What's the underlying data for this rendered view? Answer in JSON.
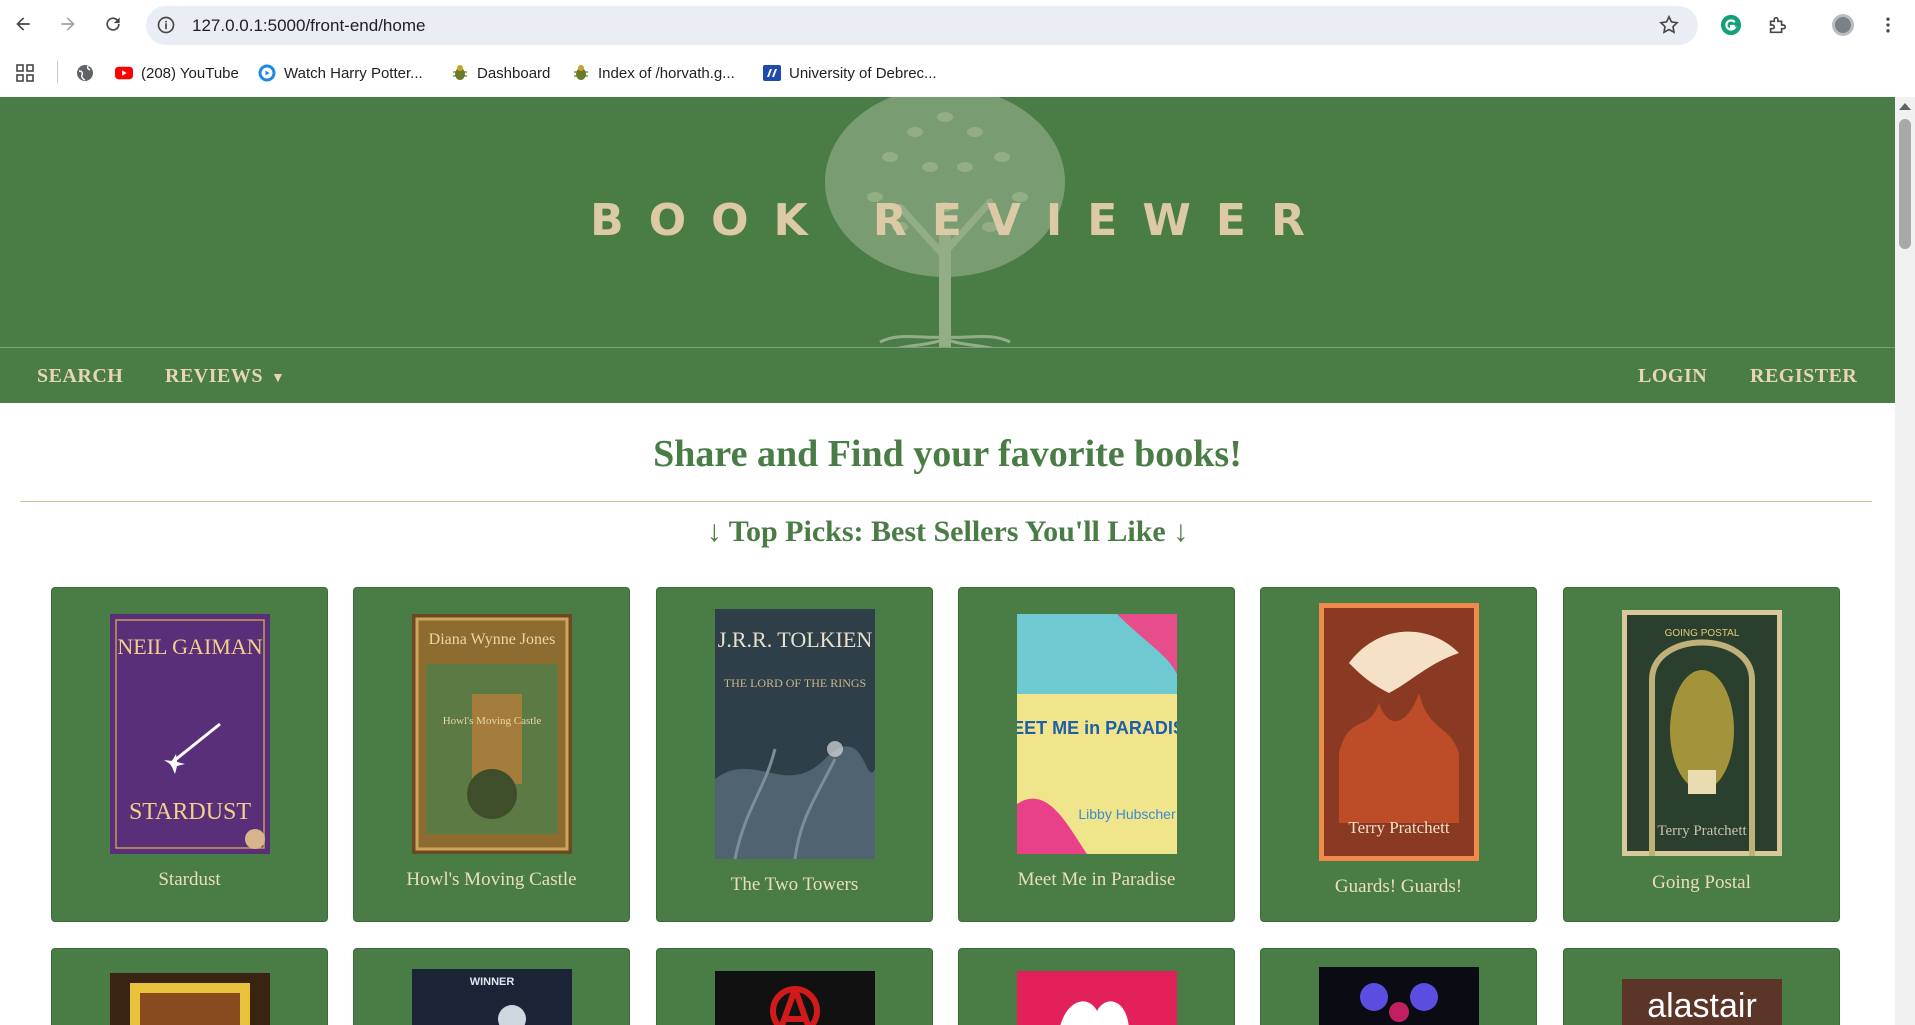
{
  "browser": {
    "url": "127.0.0.1:5000/front-end/home",
    "bookmarks": [
      {
        "label": "(208) YouTube",
        "icon": "youtube-icon"
      },
      {
        "label": "Watch Harry Potter...",
        "icon": "play-circle-icon"
      },
      {
        "label": "Dashboard",
        "icon": "bug-icon"
      },
      {
        "label": "Index of /horvath.g...",
        "icon": "bug-icon"
      },
      {
        "label": "University of Debrec...",
        "icon": "university-icon"
      }
    ]
  },
  "site": {
    "title": "BOOK REVIEWER",
    "nav": {
      "search": "SEARCH",
      "reviews": "REVIEWS",
      "login": "LOGIN",
      "register": "REGISTER"
    },
    "headline": "Share and Find your favorite books!",
    "subheadline": "↓ Top Picks: Best Sellers You'll Like ↓"
  },
  "books": [
    {
      "title": "Stardust",
      "cover": {
        "bg": "#5a2f7a",
        "accent": "#f2d08a",
        "top_text": "NEIL GAIMAN",
        "bottom_text": "STARDUST"
      }
    },
    {
      "title": "Howl's Moving Castle",
      "cover": {
        "bg": "#6b4a22",
        "accent": "#e9d7a6",
        "top_text": "Diana Wynne Jones",
        "bottom_text": "Howl's Moving Castle"
      }
    },
    {
      "title": "The Two Towers",
      "cover": {
        "bg": "#2f3f4a",
        "accent": "#e8e0cc",
        "top_text": "J.R.R. TOLKIEN",
        "bottom_text": "THE LORD OF THE RINGS"
      }
    },
    {
      "title": "Meet Me in Paradise",
      "cover": {
        "bg": "#f1e58c",
        "accent": "#1f5fa8",
        "top_text": "MEET ME in PARADISE",
        "bottom_text": "Libby Hubscher"
      }
    },
    {
      "title": "Guards! Guards!",
      "cover": {
        "bg": "#8a3a22",
        "accent": "#f4e1c6",
        "top_text": "",
        "bottom_text": "Terry Pratchett"
      }
    },
    {
      "title": "Going Postal",
      "cover": {
        "bg": "#2b3f2e",
        "accent": "#e3c979",
        "top_text": "GOING POSTAL",
        "bottom_text": "Terry Pratchett"
      }
    }
  ],
  "second_row": [
    {
      "cover": {
        "bg": "#3a2310",
        "accent": "#e8c23a",
        "top_text": ""
      }
    },
    {
      "cover": {
        "bg": "#1b2437",
        "accent": "#dce6f0",
        "top_text": "WINNER"
      }
    },
    {
      "cover": {
        "bg": "#111111",
        "accent": "#d11a1a",
        "top_text": ""
      }
    },
    {
      "cover": {
        "bg": "#e2205a",
        "accent": "#ffffff",
        "top_text": ""
      }
    },
    {
      "cover": {
        "bg": "#0b0b14",
        "accent": "#5a4de0",
        "top_text": ""
      }
    },
    {
      "cover": {
        "bg": "#5b3528",
        "accent": "#ffffff",
        "top_text": "alastair"
      }
    }
  ]
}
